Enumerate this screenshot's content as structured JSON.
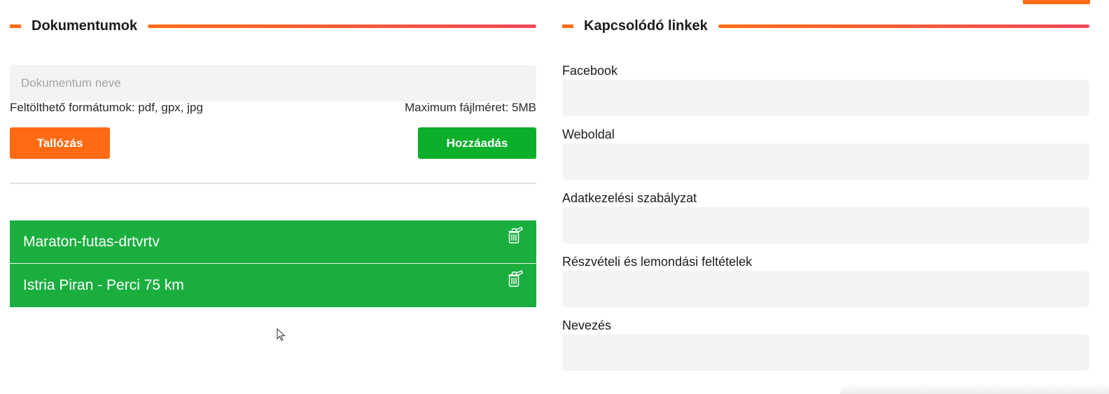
{
  "documents": {
    "title": "Dokumentumok",
    "name_placeholder": "Dokumentum neve",
    "formats_hint": "Feltölthető formátumok: pdf, gpx, jpg",
    "max_size_hint": "Maximum fájlméret: 5MB",
    "browse_label": "Tallózás",
    "add_label": "Hozzáadás",
    "items": [
      {
        "name": "Maraton-futas-drtvrtv",
        "icon": "trash-icon"
      },
      {
        "name": "Istria Piran - Perci 75 km",
        "icon": "trash-icon"
      }
    ]
  },
  "links": {
    "title": "Kapcsolódó linkek",
    "fields": [
      {
        "label": "Facebook",
        "value": ""
      },
      {
        "label": "Weboldal",
        "value": ""
      },
      {
        "label": "Adatkezelési szabályzat",
        "value": ""
      },
      {
        "label": "Részvételi és lemondási feltételek",
        "value": ""
      },
      {
        "label": "Nevezés",
        "value": ""
      }
    ]
  },
  "colors": {
    "accent_orange": "#ff6a13",
    "accent_pink": "#f2485a",
    "add_green": "#0aaf2b",
    "list_green": "#1aae3f",
    "field_bg": "#f3f3f3"
  }
}
